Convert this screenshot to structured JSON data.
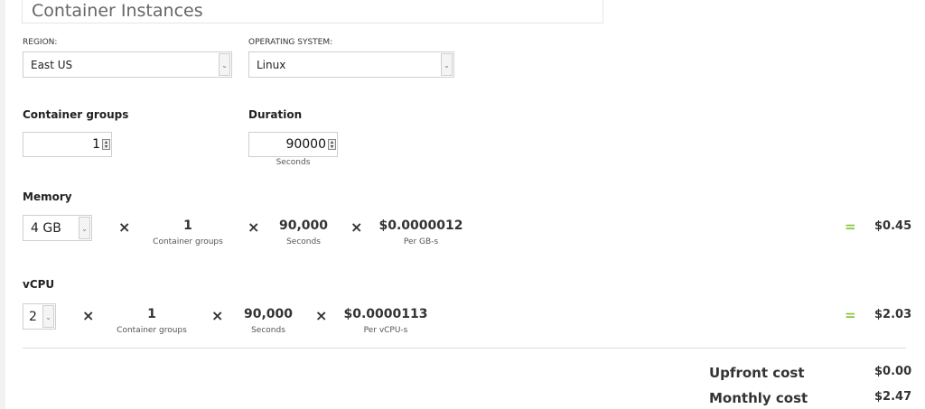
{
  "title": "Container Instances",
  "region": {
    "label": "REGION:",
    "value": "East US"
  },
  "os": {
    "label": "OPERATING SYSTEM:",
    "value": "Linux"
  },
  "groups": {
    "label": "Container groups",
    "value": "1"
  },
  "duration": {
    "label": "Duration",
    "value": "90000",
    "unit": "Seconds"
  },
  "memory": {
    "label": "Memory",
    "select_value": "4 GB",
    "times": "×",
    "groups_value": "1",
    "groups_unit": "Container groups",
    "seconds_value": "90,000",
    "seconds_unit": "Seconds",
    "rate_value": "$0.0000012",
    "rate_unit": "Per GB-s",
    "equals": "=",
    "total": "$0.45"
  },
  "vcpu": {
    "label": "vCPU",
    "select_value": "2",
    "times": "×",
    "groups_value": "1",
    "groups_unit": "Container groups",
    "seconds_value": "90,000",
    "seconds_unit": "Seconds",
    "rate_value": "$0.0000113",
    "rate_unit": "Per vCPU-s",
    "equals": "=",
    "total": "$2.03"
  },
  "summary": {
    "upfront_label": "Upfront cost",
    "upfront_value": "$0.00",
    "monthly_label": "Monthly cost",
    "monthly_value": "$2.47"
  },
  "colors": {
    "accent_equals": "#8cc63f"
  }
}
